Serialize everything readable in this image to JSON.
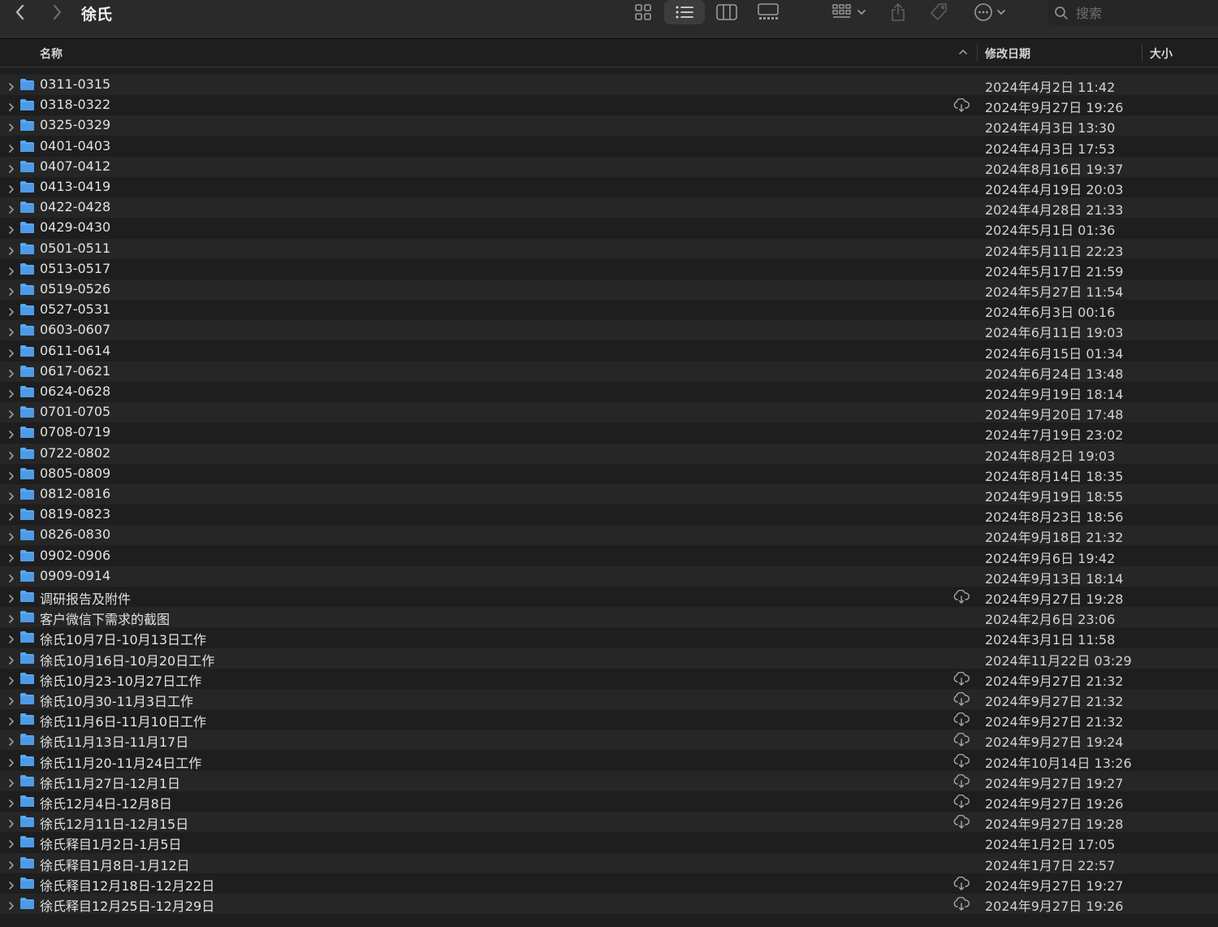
{
  "window": {
    "title": "徐氏"
  },
  "search": {
    "placeholder": "搜索"
  },
  "columns": {
    "name": "名称",
    "date": "修改日期",
    "size": "大小"
  },
  "rows": [
    {
      "name": "0311-0315",
      "date": "2024年4月2日 11:42",
      "cloud": false
    },
    {
      "name": "0318-0322",
      "date": "2024年9月27日 19:26",
      "cloud": true
    },
    {
      "name": "0325-0329",
      "date": "2024年4月3日 13:30",
      "cloud": false
    },
    {
      "name": "0401-0403",
      "date": "2024年4月3日 17:53",
      "cloud": false
    },
    {
      "name": "0407-0412",
      "date": "2024年8月16日 19:37",
      "cloud": false
    },
    {
      "name": "0413-0419",
      "date": "2024年4月19日 20:03",
      "cloud": false
    },
    {
      "name": "0422-0428",
      "date": "2024年4月28日 21:33",
      "cloud": false
    },
    {
      "name": "0429-0430",
      "date": "2024年5月1日 01:36",
      "cloud": false
    },
    {
      "name": "0501-0511",
      "date": "2024年5月11日 22:23",
      "cloud": false
    },
    {
      "name": "0513-0517",
      "date": "2024年5月17日 21:59",
      "cloud": false
    },
    {
      "name": "0519-0526",
      "date": "2024年5月27日 11:54",
      "cloud": false
    },
    {
      "name": "0527-0531",
      "date": "2024年6月3日 00:16",
      "cloud": false
    },
    {
      "name": "0603-0607",
      "date": "2024年6月11日 19:03",
      "cloud": false
    },
    {
      "name": "0611-0614",
      "date": "2024年6月15日 01:34",
      "cloud": false
    },
    {
      "name": "0617-0621",
      "date": "2024年6月24日 13:48",
      "cloud": false
    },
    {
      "name": "0624-0628",
      "date": "2024年9月19日 18:14",
      "cloud": false
    },
    {
      "name": "0701-0705",
      "date": "2024年9月20日 17:48",
      "cloud": false
    },
    {
      "name": "0708-0719",
      "date": "2024年7月19日 23:02",
      "cloud": false
    },
    {
      "name": "0722-0802",
      "date": "2024年8月2日 19:03",
      "cloud": false
    },
    {
      "name": "0805-0809",
      "date": "2024年8月14日 18:35",
      "cloud": false
    },
    {
      "name": "0812-0816",
      "date": "2024年9月19日 18:55",
      "cloud": false
    },
    {
      "name": "0819-0823",
      "date": "2024年8月23日 18:56",
      "cloud": false
    },
    {
      "name": "0826-0830",
      "date": "2024年9月18日 21:32",
      "cloud": false
    },
    {
      "name": "0902-0906",
      "date": "2024年9月6日 19:42",
      "cloud": false
    },
    {
      "name": "0909-0914",
      "date": "2024年9月13日 18:14",
      "cloud": false
    },
    {
      "name": "调研报告及附件",
      "date": "2024年9月27日 19:28",
      "cloud": true
    },
    {
      "name": "客户微信下需求的截图",
      "date": "2024年2月6日 23:06",
      "cloud": false
    },
    {
      "name": "徐氏10月7日-10月13日工作",
      "date": "2024年3月1日 11:58",
      "cloud": false
    },
    {
      "name": "徐氏10月16日-10月20日工作",
      "date": "2024年11月22日 03:29",
      "cloud": false
    },
    {
      "name": "徐氏10月23-10月27日工作",
      "date": "2024年9月27日 21:32",
      "cloud": true
    },
    {
      "name": "徐氏10月30-11月3日工作",
      "date": "2024年9月27日 21:32",
      "cloud": true
    },
    {
      "name": "徐氏11月6日-11月10日工作",
      "date": "2024年9月27日 21:32",
      "cloud": true
    },
    {
      "name": "徐氏11月13日-11月17日",
      "date": "2024年9月27日 19:24",
      "cloud": true
    },
    {
      "name": "徐氏11月20-11月24日工作",
      "date": "2024年10月14日 13:26",
      "cloud": true
    },
    {
      "name": "徐氏11月27日-12月1日",
      "date": "2024年9月27日 19:27",
      "cloud": true
    },
    {
      "name": "徐氏12月4日-12月8日",
      "date": "2024年9月27日 19:26",
      "cloud": true
    },
    {
      "name": "徐氏12月11日-12月15日",
      "date": "2024年9月27日 19:28",
      "cloud": true
    },
    {
      "name": "徐氏释目1月2日-1月5日",
      "date": "2024年1月2日 17:05",
      "cloud": false
    },
    {
      "name": "徐氏释目1月8日-1月12日",
      "date": "2024年1月7日 22:57",
      "cloud": false
    },
    {
      "name": "徐氏释目12月18日-12月22日",
      "date": "2024年9月27日 19:27",
      "cloud": true
    },
    {
      "name": "徐氏释目12月25日-12月29日",
      "date": "2024年9月27日 19:26",
      "cloud": true
    }
  ],
  "icons": {
    "back": "chevron-left-icon",
    "forward": "chevron-right-icon",
    "icon_view": "grid-icon",
    "list_view": "list-icon",
    "column_view": "columns-icon",
    "gallery_view": "gallery-icon",
    "group": "group-icon",
    "share": "share-icon",
    "tag": "tag-icon",
    "more": "ellipsis-circle-icon",
    "search": "search-icon",
    "folder": "folder-icon",
    "cloud": "cloud-download-icon"
  },
  "colors": {
    "folder": "#5aa9f0",
    "background": "#1e1e1e",
    "row_alt": "#262626"
  }
}
